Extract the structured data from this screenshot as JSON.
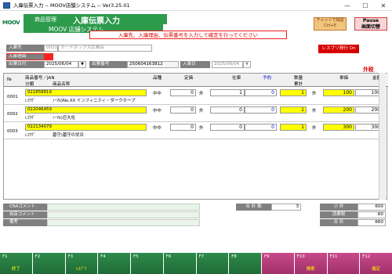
{
  "window": {
    "title": "入庫伝票入力 -- MOOV店舗システム -- Ver3.25.01",
    "min": "—",
    "max": "☐",
    "close": "✕"
  },
  "header": {
    "logo": "MOOV",
    "logo_sub": "MOOV",
    "menu": "商品管理",
    "title": "入庫伝票入力",
    "system": "MOOV 店舗システム",
    "message": "入庫先、入庫理由、伝票番号を入力して確定を行ってください",
    "chat_btn": "チャットで相談",
    "chat_sub": "Ctrl+E",
    "pause_btn": "Pause",
    "pause_sub": "画面切替"
  },
  "form": {
    "warehouse_label": "入庫先",
    "warehouse_code": "0021",
    "warehouse_name": "カードボックス広島店",
    "reason_label": "入庫理由",
    "reason_value": "",
    "date_label": "出票日付",
    "date_value": "2025/06/04",
    "slip_label": "出票番号",
    "slip_value": "250604163812",
    "in_date_label": "入庫日",
    "in_date_value": "2025/06/04"
  },
  "flags": {
    "reprint": "レスブリ発行  On",
    "foreign": "外税"
  },
  "grid": {
    "headers": {
      "no": "№",
      "code": "商品番号／JAN",
      "cat": "分類",
      "name": "商品名称",
      "quality": "品種",
      "fixed": "定価",
      "stock": "在庫",
      "reserve": "予約",
      "qty": "数量",
      "cum": "累計",
      "price": "単価",
      "amount": "金額"
    },
    "rows": [
      {
        "no": "0001",
        "jan": "021858819",
        "cat": "ﾚｺｳｹﾞ",
        "name": "ﾉｰﾏﾙ)No.XX インフィニティ・ダークホープ",
        "grade": "中中",
        "fixed": "0",
        "out": "外",
        "stock": "1",
        "reserve": "0",
        "qty": "1",
        "tax": "外",
        "price": "100",
        "amount": "100"
      },
      {
        "no": "0002",
        "jan": "022046459",
        "cat": "ﾚｺｳｹﾞ",
        "name": "ﾉｰﾏﾙ)巨大化",
        "grade": "中中",
        "fixed": "0",
        "out": "外",
        "stock": "0",
        "reserve": "0",
        "qty": "1",
        "tax": "外",
        "price": "200",
        "amount": "200"
      },
      {
        "no": "0003",
        "jan": "022134079",
        "cat": "ﾚｺｳｹﾞ",
        "name": "墓守)墓守の伏兵",
        "grade": "中中",
        "fixed": "0",
        "out": "外",
        "stock": "0",
        "reserve": "0",
        "qty": "1",
        "tax": "外",
        "price": "300",
        "amount": "300"
      }
    ]
  },
  "footer": {
    "cna_label": "CNAコメント",
    "own_label": "自店コメント",
    "memo_label": "備考",
    "count_label": "合 計 数",
    "count_value": "3",
    "subtotal_label": "小 計",
    "subtotal_value": "600",
    "tax_label": "消費税",
    "tax_value": "60",
    "total_label": "合 計",
    "total_value": "660"
  },
  "fkeys": [
    {
      "n": "F1",
      "l": "終了"
    },
    {
      "n": "F2",
      "l": ""
    },
    {
      "n": "F3",
      "l": "ﾚｽﾌﾞﾘ"
    },
    {
      "n": "F4",
      "l": ""
    },
    {
      "n": "F5",
      "l": ""
    },
    {
      "n": "F6",
      "l": ""
    },
    {
      "n": "F7",
      "l": ""
    },
    {
      "n": "F8",
      "l": ""
    },
    {
      "n": "F9",
      "l": ""
    },
    {
      "n": "F10",
      "l": "検索"
    },
    {
      "n": "F11",
      "l": ""
    },
    {
      "n": "F12",
      "l": "確定"
    }
  ]
}
